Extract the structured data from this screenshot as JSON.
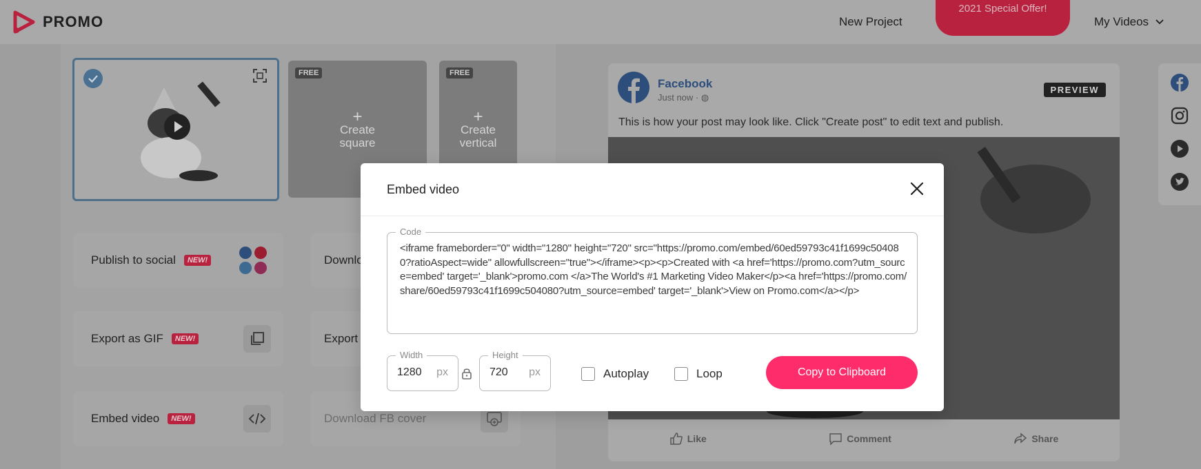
{
  "header": {
    "logo_text": "PROMO",
    "nav_new_project": "New Project",
    "offer_button": "2021 Special Offer!",
    "my_videos": "My Videos"
  },
  "thumbnails": {
    "square_badge": "FREE",
    "square_label_1": "Create",
    "square_label_2": "square",
    "vertical_badge": "FREE",
    "vertical_label_1": "Create",
    "vertical_label_2": "vertical"
  },
  "actions": {
    "publish_social": "Publish to social",
    "publish_badge": "NEW!",
    "download_partial": "Downlo",
    "export_gif": "Export as GIF",
    "export_gif_badge": "NEW!",
    "export_partial": "Export",
    "embed_video": "Embed video",
    "embed_badge": "NEW!",
    "download_fb_cover": "Download FB cover"
  },
  "preview": {
    "page_name": "Facebook",
    "timestamp": "Just now ·",
    "badge": "PREVIEW",
    "caption": "This is how your post may look like. Click \"Create post\" to edit text and publish.",
    "like": "Like",
    "comment": "Comment",
    "share": "Share"
  },
  "modal": {
    "title": "Embed video",
    "code_legend": "Code",
    "code": "<iframe frameborder=\"0\" width=\"1280\" height=\"720\" src=\"https://promo.com/embed/60ed59793c41f1699c504080?ratioAspect=wide\" allowfullscreen=\"true\"></iframe><p><p>Created with <a href='https://promo.com?utm_source=embed' target='_blank'>promo.com  </a>The World's #1 Marketing Video Maker</p><a href='https://promo.com/share/60ed59793c41f1699c504080?utm_source=embed' target='_blank'>View on Promo.com</a></p>",
    "width_label": "Width",
    "width_value": "1280",
    "height_label": "Height",
    "height_value": "720",
    "unit": "px",
    "autoplay_label": "Autoplay",
    "loop_label": "Loop",
    "copy_button": "Copy to Clipboard"
  },
  "colors": {
    "accent_pink": "#ff2c6b",
    "facebook_blue": "#2d4d7b",
    "selected_border": "#4d6f8a"
  }
}
